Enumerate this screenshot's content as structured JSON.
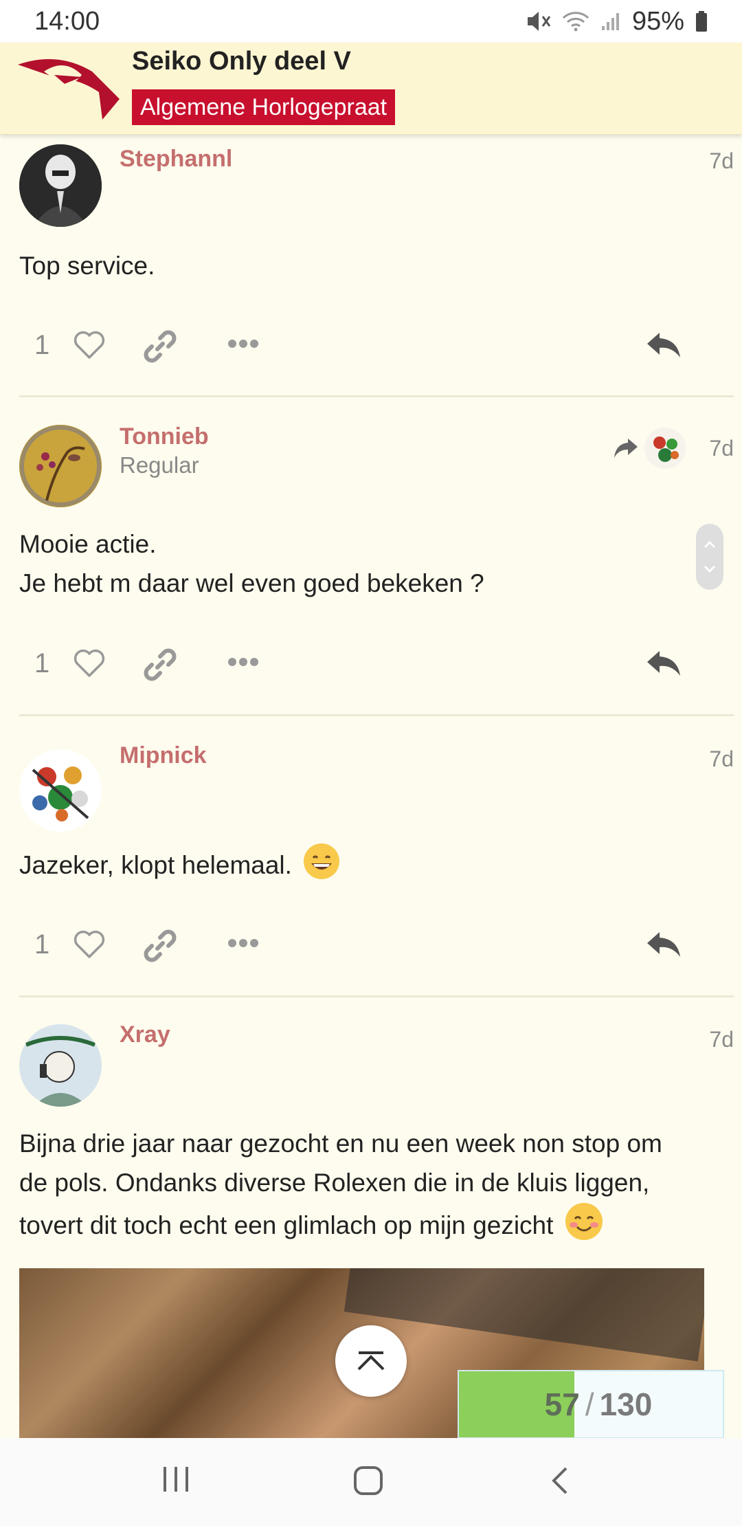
{
  "status_bar": {
    "time": "14:00",
    "battery": "95%"
  },
  "header": {
    "title": "Seiko Only deel V",
    "category": "Algemene Horlogepraat"
  },
  "posts": [
    {
      "username": "Stephannl",
      "user_title": "",
      "date": "7d",
      "body": [
        "Top service."
      ],
      "likes": "1"
    },
    {
      "username": "Tonnieb",
      "user_title": "Regular",
      "date": "7d",
      "body": [
        "Mooie actie.",
        "Je hebt m daar wel even goed bekeken ?"
      ],
      "likes": "1"
    },
    {
      "username": "Mipnick",
      "user_title": "",
      "date": "7d",
      "body": [
        "Jazeker, klopt helemaal."
      ],
      "likes": "1"
    },
    {
      "username": "Xray",
      "user_title": "",
      "date": "7d",
      "body": [
        "Bijna drie jaar naar gezocht en nu een week non stop om",
        "de pols. Ondanks diverse Rolexen die in de kluis liggen,",
        "tovert dit toch echt een glimlach op mijn gezicht"
      ]
    }
  ],
  "progress": {
    "current": "57",
    "separator": "/",
    "total": "130",
    "fraction": 0.438
  },
  "colors": {
    "accent": "#c8102e",
    "username": "#c56e6e",
    "background": "#fdfcee",
    "header_bg": "#fcf6d2",
    "progress_fill": "#8ccf5a"
  }
}
